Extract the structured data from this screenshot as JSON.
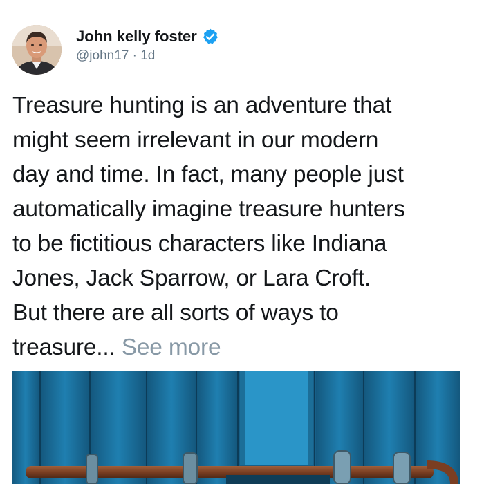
{
  "author": {
    "display_name": "John kelly foster",
    "handle": "@john17",
    "separator": "·",
    "time_ago": "1d",
    "verified": true,
    "verified_color": "#1da1f2"
  },
  "tweet": {
    "text_lines": [
      "Treasure hunting is an adventure that",
      "might seem irrelevant in our modern",
      "day and time. In fact, many people just",
      "automatically imagine treasure hunters",
      "to be fictitious characters like Indiana",
      "Jones, Jack Sparrow, or Lara Croft.",
      "But there are all sorts of ways to",
      "treasure... "
    ],
    "see_more_label": "See more"
  },
  "media": {
    "icon": "blue-wooden-door-with-rusty-latch-photo"
  },
  "colors": {
    "text": "#14171a",
    "secondary": "#657786",
    "see_more": "#8899a6",
    "door_blue": "#1a6f9c",
    "rust": "#8a4a2a"
  }
}
